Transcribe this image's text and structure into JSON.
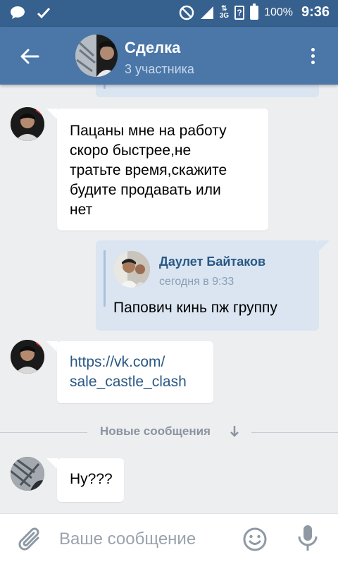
{
  "status_bar": {
    "battery": "100%",
    "time": "9:36",
    "network": "3G",
    "icons": [
      "message-icon",
      "check-icon",
      "dnd-icon",
      "signal-icon",
      "data-icon",
      "sim-icon",
      "battery-icon"
    ]
  },
  "header": {
    "title": "Сделка",
    "subtitle": "3 участника",
    "icons": [
      "back-arrow-icon",
      "more-icon"
    ]
  },
  "colors": {
    "status_bar": "#36608d",
    "header": "#4a76a8",
    "background": "#edeef0",
    "incoming_bubble": "#ffffff",
    "outgoing_bubble": "#dae5f1",
    "link": "#2a5885"
  },
  "messages": [
    {
      "direction": "in",
      "lines": [
        "Пацаны мне на работу",
        "скоро быстрее,не",
        "тратьте время,скажите",
        "будите продавать или",
        "нет"
      ]
    },
    {
      "direction": "out",
      "forwarded": {
        "author": "Даулет Байтаков",
        "time": "сегодня в 9:33",
        "text": "Папович кинь пж группу"
      }
    },
    {
      "direction": "in",
      "link_lines": [
        "https://vk.com/",
        "sale_castle_clash"
      ]
    },
    {
      "direction": "in",
      "text": "Ну???"
    }
  ],
  "divider": {
    "label": "Новые сообщения"
  },
  "composer": {
    "placeholder": "Ваше сообщение",
    "icons": [
      "attach-icon",
      "emoji-icon",
      "mic-icon"
    ]
  }
}
